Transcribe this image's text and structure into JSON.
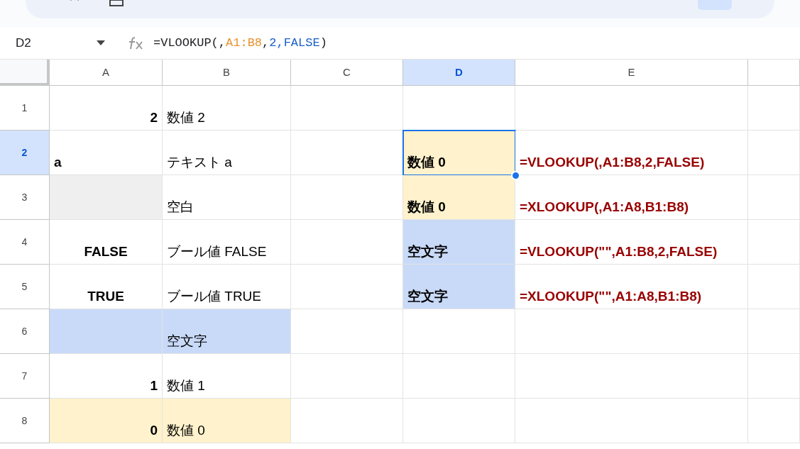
{
  "name_box": "D2",
  "formula": [
    {
      "text": "=VLOOKUP(,",
      "color": "#202124"
    },
    {
      "text": "A1:B8",
      "color": "#e8912d"
    },
    {
      "text": ",",
      "color": "#202124"
    },
    {
      "text": "2,FALSE",
      "color": "#1a5fc7"
    },
    {
      "text": ")",
      "color": "#202124"
    }
  ],
  "columns": [
    {
      "label": "A",
      "selected": false
    },
    {
      "label": "B",
      "selected": false
    },
    {
      "label": "C",
      "selected": false
    },
    {
      "label": "D",
      "selected": true
    },
    {
      "label": "E",
      "selected": false
    },
    {
      "selected": false
    }
  ],
  "rows": [
    {
      "label": "1",
      "selected": false,
      "cells": [
        {
          "text": "2",
          "kind": "number",
          "bold": true
        },
        {
          "text": "数値 2",
          "kind": "text",
          "bold": false
        },
        {},
        {},
        {},
        {}
      ]
    },
    {
      "label": "2",
      "selected": true,
      "cells": [
        {
          "text": "a",
          "kind": "text",
          "bold": true
        },
        {
          "text": "テキスト a",
          "kind": "text",
          "bold": false
        },
        {},
        {
          "text": "数値 0",
          "kind": "text",
          "bold": true,
          "color": "#fff2cc",
          "selected": true
        },
        {
          "text": "=VLOOKUP(,A1:B8,2,FALSE)",
          "kind": "formula",
          "bold": true
        },
        {}
      ]
    },
    {
      "label": "3",
      "selected": false,
      "cells": [
        {
          "color": "#efefef"
        },
        {
          "text": "空白",
          "kind": "text",
          "bold": false
        },
        {},
        {
          "text": "数値 0",
          "kind": "text",
          "bold": true,
          "color": "#fff2cc"
        },
        {
          "text": "=XLOOKUP(,A1:A8,B1:B8)",
          "kind": "formula",
          "bold": true
        },
        {}
      ]
    },
    {
      "label": "4",
      "selected": false,
      "cells": [
        {
          "text": "FALSE",
          "kind": "boolean",
          "bold": true
        },
        {
          "text": "ブール値 FALSE",
          "kind": "text",
          "bold": false
        },
        {},
        {
          "text": "空文字",
          "kind": "text",
          "bold": true,
          "color": "#c9daf8"
        },
        {
          "text": "=VLOOKUP(\"\",A1:B8,2,FALSE)",
          "kind": "formula",
          "bold": true
        },
        {}
      ]
    },
    {
      "label": "5",
      "selected": false,
      "cells": [
        {
          "text": "TRUE",
          "kind": "boolean",
          "bold": true
        },
        {
          "text": "ブール値 TRUE",
          "kind": "text",
          "bold": false
        },
        {},
        {
          "text": "空文字",
          "kind": "text",
          "bold": true,
          "color": "#c9daf8"
        },
        {
          "text": "=XLOOKUP(\"\",A1:A8,B1:B8)",
          "kind": "formula",
          "bold": true
        },
        {}
      ]
    },
    {
      "label": "6",
      "selected": false,
      "cells": [
        {
          "color": "#c9daf8"
        },
        {
          "text": "空文字",
          "kind": "text",
          "bold": false,
          "color": "#c9daf8"
        },
        {},
        {},
        {},
        {}
      ]
    },
    {
      "label": "7",
      "selected": false,
      "cells": [
        {
          "text": "1",
          "kind": "number",
          "bold": true
        },
        {
          "text": "数値 1",
          "kind": "text",
          "bold": false
        },
        {},
        {},
        {},
        {}
      ]
    },
    {
      "label": "8",
      "selected": false,
      "cells": [
        {
          "text": "0",
          "kind": "number",
          "bold": true,
          "color": "#fff2cc"
        },
        {
          "text": "数値 0",
          "kind": "text",
          "bold": false,
          "color": "#fff2cc"
        },
        {},
        {},
        {},
        {}
      ]
    }
  ]
}
